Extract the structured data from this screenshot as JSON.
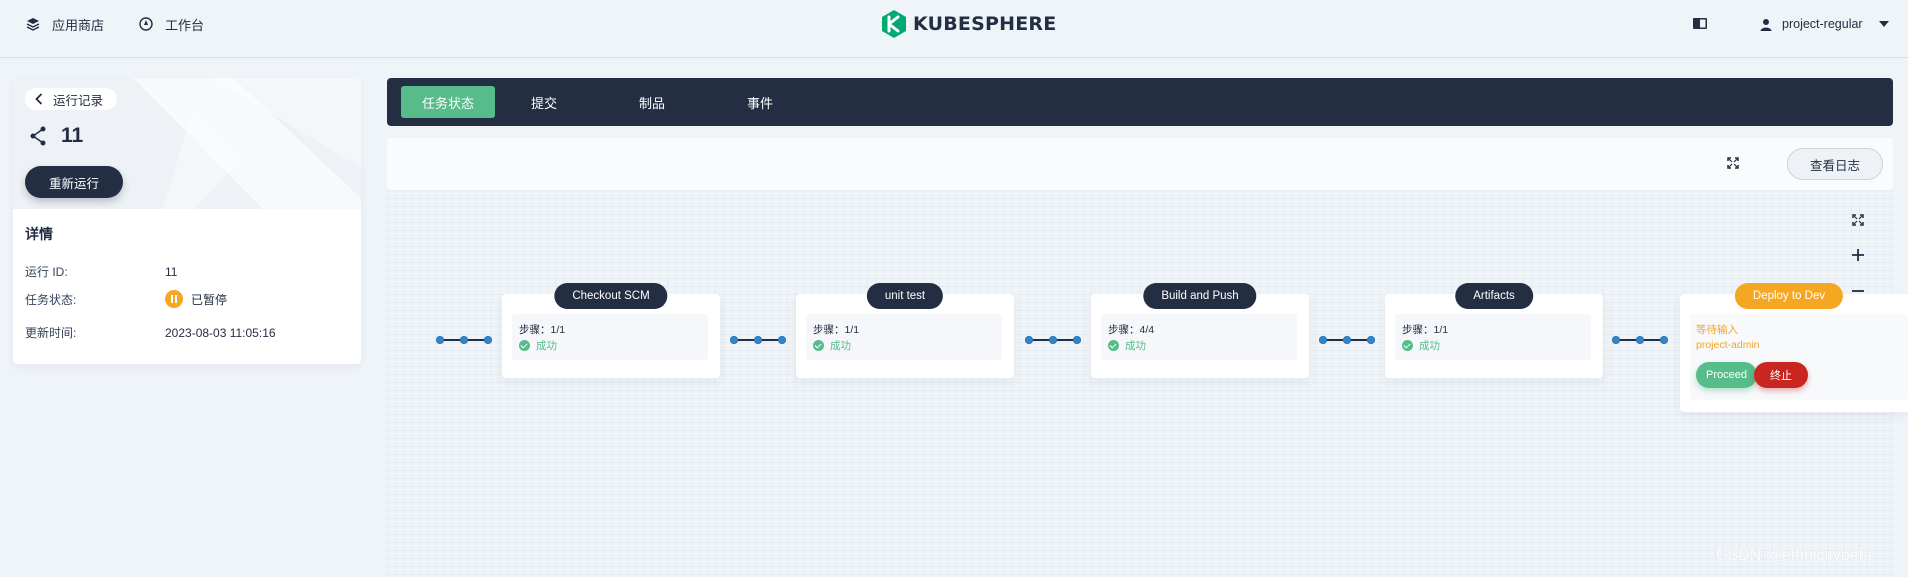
{
  "header": {
    "app_store": "应用商店",
    "workbench": "工作台",
    "logo": "KUBESPHERE",
    "user": "project-regular"
  },
  "left_panel": {
    "back_label": "运行记录",
    "run_number": "11",
    "rerun_label": "重新运行",
    "details_title": "详情",
    "fields": [
      {
        "label": "运行 ID:",
        "value": "11"
      },
      {
        "label": "任务状态:",
        "value": "已暂停"
      },
      {
        "label": "更新时间:",
        "value": "2023-08-03 11:05:16"
      }
    ]
  },
  "tabs": [
    "任务状态",
    "提交",
    "制品",
    "事件"
  ],
  "toolbar": {
    "view_logs": "查看日志"
  },
  "pipeline": {
    "stages": [
      {
        "name": "Checkout SCM",
        "steps": "步骤：1/1",
        "status": "成功"
      },
      {
        "name": "unit test",
        "steps": "步骤：1/1",
        "status": "成功"
      },
      {
        "name": "Build and Push",
        "steps": "步骤：4/4",
        "status": "成功"
      },
      {
        "name": "Artifacts",
        "steps": "步骤：1/1",
        "status": "成功"
      }
    ],
    "input_stage": {
      "name": "Deploy to Dev",
      "waiting": "等待输入",
      "approver": "project-admin",
      "proceed": "Proceed",
      "abort": "终止"
    }
  },
  "colors": {
    "dark": "#242e42",
    "success": "#55bc8a",
    "warning": "#f5a623",
    "danger": "#ca2621",
    "node": "#3385ca"
  },
  "watermark": "CSDN @ethnicitybeta"
}
